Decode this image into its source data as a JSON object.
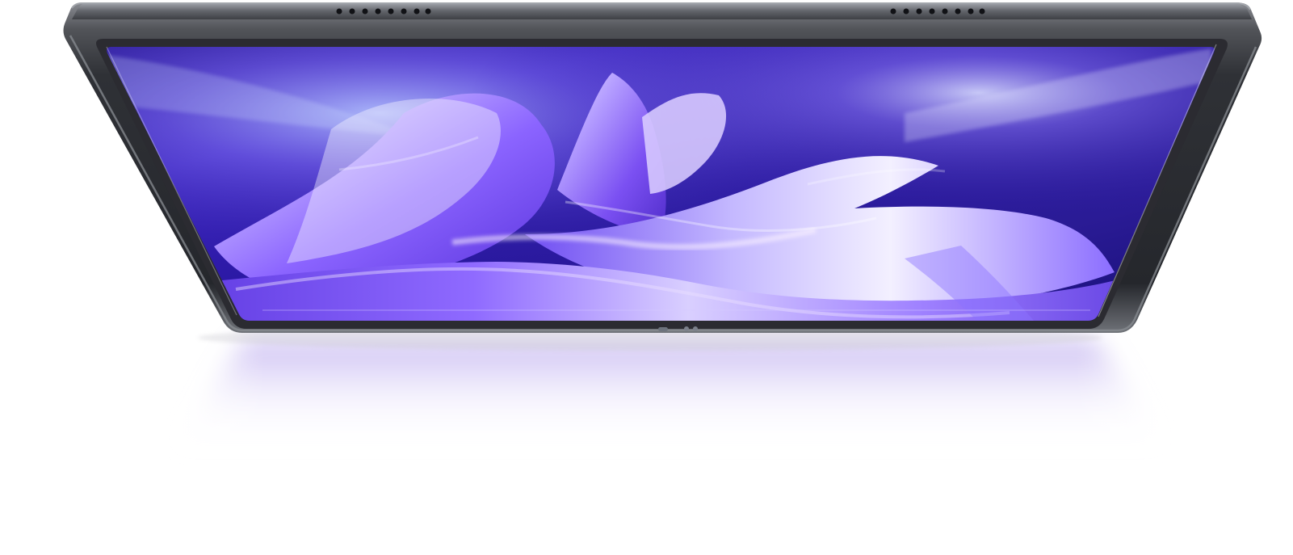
{
  "scene": {
    "subject": "tablet-product-render",
    "icons": [
      "speaker-grille-icon",
      "front-camera-icon",
      "light-sensor-icon",
      "wallpaper-petals"
    ],
    "colors": {
      "background": "#ffffff",
      "frame_dark": "#2a2c31",
      "frame_edge": "#7d8087",
      "bezel": "#2b2b31",
      "screen_deep": "#17107e",
      "screen_mid": "#4b2fd0",
      "petal_light": "#d8ccff",
      "petal_mid": "#9d7cff",
      "reflection": "#b9a6ef"
    }
  }
}
